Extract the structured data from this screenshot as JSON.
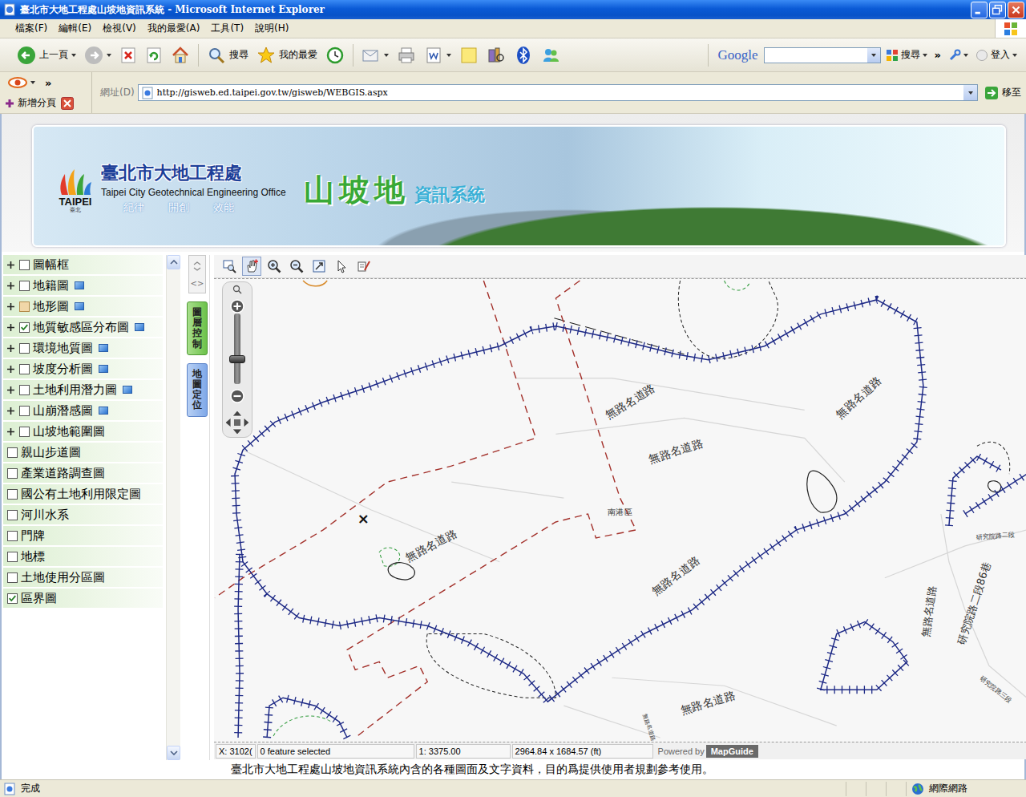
{
  "window": {
    "title": "臺北市大地工程處山坡地資訊系統 - Microsoft Internet Explorer"
  },
  "menu": [
    "檔案(F)",
    "編輯(E)",
    "檢視(V)",
    "我的最愛(A)",
    "工具(T)",
    "說明(H)"
  ],
  "toolbar": {
    "back": "上一頁",
    "search": "搜尋",
    "favorites": "我的最愛",
    "google_logo": "Google",
    "google_search": "搜尋",
    "more": "»",
    "login": "登入"
  },
  "tab_strip": {
    "more": "»",
    "new_tab": "新增分頁"
  },
  "address_bar": {
    "label": "網址(D)",
    "url": "http://gisweb.ed.taipei.gov.tw/gisweb/WEBGIS.aspx",
    "go": "移至"
  },
  "banner": {
    "logo_word": "TAIPEI",
    "logo_sub": "臺北",
    "org": "臺北市大地工程處",
    "org_en": "Taipei City Geotechnical Engineering Office",
    "mottos": [
      "紀律",
      "開創",
      "效能"
    ],
    "system": "山坡地",
    "system_suffix": "資訊系統"
  },
  "layers": [
    {
      "label": "圖幅框",
      "expandable": true,
      "checked": false,
      "indeterminate": false,
      "info": false
    },
    {
      "label": "地籍圖",
      "expandable": true,
      "checked": false,
      "indeterminate": false,
      "info": true
    },
    {
      "label": "地形圖",
      "expandable": true,
      "checked": false,
      "indeterminate": true,
      "info": true
    },
    {
      "label": "地質敏感區分布圖",
      "expandable": true,
      "checked": true,
      "indeterminate": false,
      "info": true
    },
    {
      "label": "環境地質圖",
      "expandable": true,
      "checked": false,
      "indeterminate": false,
      "info": true
    },
    {
      "label": "坡度分析圖",
      "expandable": true,
      "checked": false,
      "indeterminate": false,
      "info": true
    },
    {
      "label": "土地利用潛力圖",
      "expandable": true,
      "checked": false,
      "indeterminate": false,
      "info": true
    },
    {
      "label": "山崩潛感圖",
      "expandable": true,
      "checked": false,
      "indeterminate": false,
      "info": true
    },
    {
      "label": "山坡地範圍圖",
      "expandable": true,
      "checked": false,
      "indeterminate": false,
      "info": false
    },
    {
      "label": "親山步道圖",
      "expandable": false,
      "checked": false,
      "indeterminate": false,
      "info": false
    },
    {
      "label": "產業道路調查圖",
      "expandable": false,
      "checked": false,
      "indeterminate": false,
      "info": false
    },
    {
      "label": "國公有土地利用限定圖",
      "expandable": false,
      "checked": false,
      "indeterminate": false,
      "info": false
    },
    {
      "label": "河川水系",
      "expandable": false,
      "checked": false,
      "indeterminate": false,
      "info": false
    },
    {
      "label": "門牌",
      "expandable": false,
      "checked": false,
      "indeterminate": false,
      "info": false
    },
    {
      "label": "地標",
      "expandable": false,
      "checked": false,
      "indeterminate": false,
      "info": false
    },
    {
      "label": "土地使用分區圖",
      "expandable": false,
      "checked": false,
      "indeterminate": false,
      "info": false
    },
    {
      "label": "區界圖",
      "expandable": false,
      "checked": true,
      "indeterminate": false,
      "info": false
    }
  ],
  "side_tabs": {
    "toggle": "<>",
    "tabs": [
      {
        "label": "圖層控制",
        "selected": true
      },
      {
        "label": "地圖定位",
        "selected": false
      }
    ]
  },
  "map_tools": [
    {
      "kind": "zoom-window",
      "selected": false
    },
    {
      "kind": "pan",
      "selected": true
    },
    {
      "kind": "zoom-in",
      "selected": false
    },
    {
      "kind": "zoom-out",
      "selected": false
    },
    {
      "kind": "zoom-extent",
      "selected": false
    },
    {
      "kind": "select",
      "selected": false
    },
    {
      "kind": "measure",
      "selected": false
    }
  ],
  "zoom": {
    "level": 0.33
  },
  "map": {
    "labels": [
      "無路名道路",
      "無路名道路",
      "無路名道路",
      "南港區",
      "無路名道路",
      "無路名道路",
      "無路名道路",
      "研究院路二段86巷",
      "研究院路二段",
      "研究院路三段",
      "無路名道路",
      "無路名道路"
    ],
    "marker": "×"
  },
  "map_status": {
    "coords": "X: 3102(",
    "selection": "0 feature selected",
    "scale": "1: 3375.00",
    "extent": "2964.84 x 1684.57 (ft)",
    "powered_by": "Powered by",
    "engine": "MapGuide"
  },
  "footer": "臺北市大地工程處山坡地資訊系統內含的各種圖面及文字資料，目的爲提供使用者規劃參考使用。",
  "status_bar": {
    "text": "完成",
    "zone": "網際網路"
  }
}
